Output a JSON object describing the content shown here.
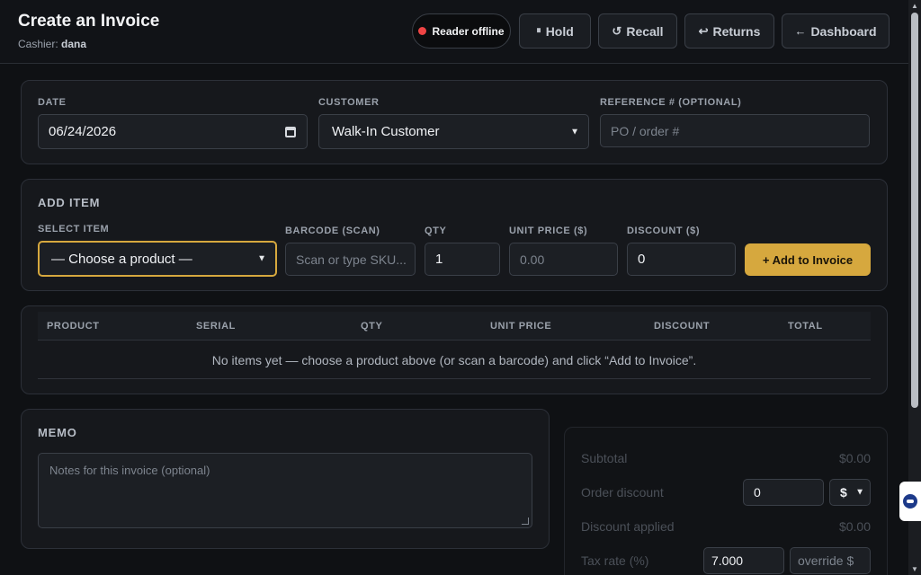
{
  "header": {
    "title": "Create an Invoice",
    "cashier_label": "Cashier:",
    "cashier_name": "dana",
    "reader_status": "Reader offline",
    "status_color": "#ef4444",
    "buttons": {
      "hold": "Hold",
      "recall": "Recall",
      "returns": "Returns",
      "dashboard": "Dashboard"
    },
    "icons": {
      "hold": "pause-icon",
      "recall": "rotate-icon",
      "returns": "return-arrow-icon",
      "dashboard": "arrow-left-icon"
    }
  },
  "invoice_info": {
    "date_label": "DATE",
    "date_value": "06/24/2026",
    "customer_label": "CUSTOMER",
    "customer_value": "Walk-In Customer",
    "reference_label": "REFERENCE # (OPTIONAL)",
    "reference_placeholder": "PO / order #"
  },
  "add_item": {
    "section_title": "ADD ITEM",
    "select_label": "SELECT ITEM",
    "select_value": "— Choose a product —",
    "barcode_label": "BARCODE (SCAN)",
    "barcode_placeholder": "Scan or type SKU...",
    "qty_label": "QTY",
    "qty_value": "1",
    "unit_price_label": "UNIT PRICE ($)",
    "unit_price_placeholder": "0.00",
    "discount_label": "DISCOUNT ($)",
    "discount_value": "0",
    "add_button": "+ Add to Invoice",
    "accent_color": "#d6a83e"
  },
  "items_table": {
    "columns": [
      "PRODUCT",
      "SERIAL",
      "QTY",
      "UNIT PRICE",
      "DISCOUNT",
      "TOTAL"
    ],
    "empty_message": "No items yet — choose a product above (or scan a barcode) and click “Add to Invoice”."
  },
  "memo": {
    "section_title": "MEMO",
    "placeholder": "Notes for this invoice (optional)"
  },
  "summary": {
    "subtotal_label": "Subtotal",
    "subtotal_value": "$0.00",
    "order_discount_label": "Order discount",
    "order_discount_value": "0",
    "order_discount_unit": "$",
    "discount_applied_label": "Discount applied",
    "discount_applied_value": "$0.00",
    "tax_rate_label": "Tax rate (%)",
    "tax_rate_value": "7.000",
    "tax_override_placeholder": "override $"
  }
}
